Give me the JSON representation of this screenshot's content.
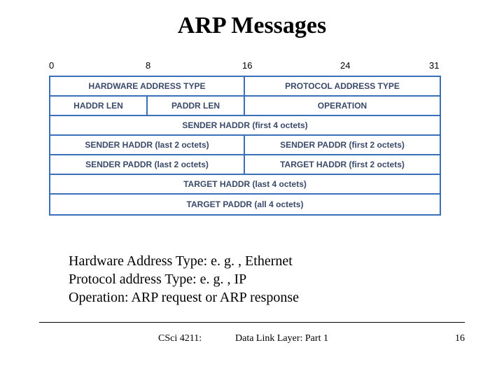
{
  "title": "ARP Messages",
  "bit_ticks": {
    "t0": "0",
    "t8": "8",
    "t16": "16",
    "t24": "24",
    "t31": "31"
  },
  "rows": {
    "r1": {
      "c1": "HARDWARE ADDRESS TYPE",
      "c2": "PROTOCOL ADDRESS TYPE"
    },
    "r2": {
      "c1": "HADDR LEN",
      "c2": "PADDR LEN",
      "c3": "OPERATION"
    },
    "r3": {
      "c1": "SENDER HADDR (first 4 octets)"
    },
    "r4": {
      "c1": "SENDER HADDR (last 2 octets)",
      "c2": "SENDER PADDR (first 2 octets)"
    },
    "r5": {
      "c1": "SENDER PADDR (last 2 octets)",
      "c2": "TARGET HADDR (first 2 octets)"
    },
    "r6": {
      "c1": "TARGET HADDR (last 4 octets)"
    },
    "r7": {
      "c1": "TARGET PADDR (all 4 octets)"
    }
  },
  "body": {
    "l1": "Hardware Address Type: e. g. , Ethernet",
    "l2": "Protocol address Type: e. g. , IP",
    "l3": "Operation: ARP request or ARP response"
  },
  "footer": {
    "course": "CSci 4211:",
    "topic": "Data Link Layer: Part 1",
    "page": "16"
  }
}
